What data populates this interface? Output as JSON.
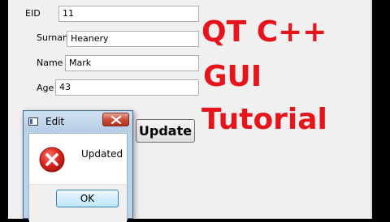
{
  "form": {
    "eid_label": "EID",
    "eid_value": "11",
    "surname_label": "Surname",
    "surname_value": "Heanery",
    "name_label": "Name",
    "name_value": "Mark",
    "age_label": "Age",
    "age_value": "43",
    "update_label": "Update"
  },
  "overlay": {
    "line1": "QT C++",
    "line2": "GUI",
    "line3": "Tutorial",
    "color": "#e8141b"
  },
  "dialog": {
    "title": "Edit",
    "message": "Updated",
    "ok_label": "OK",
    "icon": "error-icon",
    "close_icon": "close-icon"
  }
}
